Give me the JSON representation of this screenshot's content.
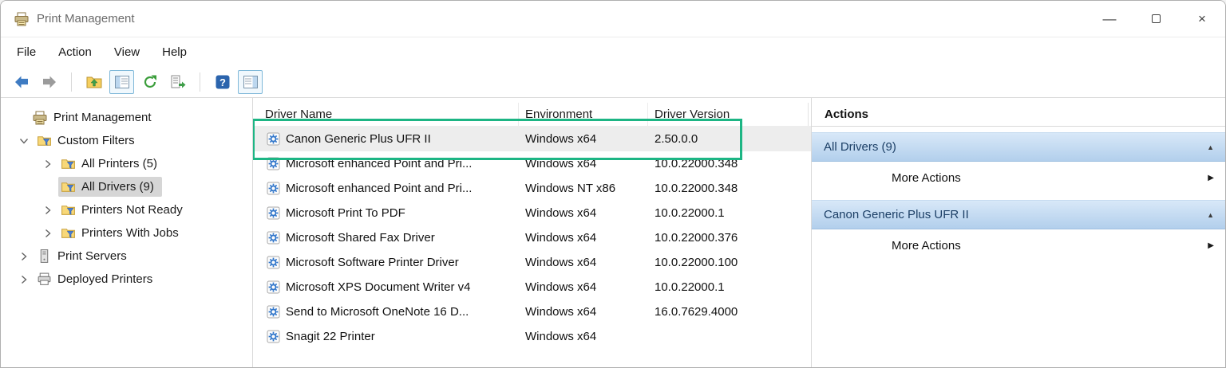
{
  "window": {
    "title": "Print Management"
  },
  "icons": {
    "minimize_glyph": "—",
    "close_glyph": "×",
    "collapse_glyph": "▲",
    "submenu_glyph": "▶"
  },
  "menu": {
    "items": [
      "File",
      "Action",
      "View",
      "Help"
    ]
  },
  "toolbar": {
    "buttons": [
      {
        "name": "back-button",
        "icon": "back-icon"
      },
      {
        "name": "forward-button",
        "icon": "forward-icon"
      },
      {
        "type": "separator"
      },
      {
        "name": "up-level-button",
        "icon": "folder-up-icon"
      },
      {
        "name": "console-tree-toggle-button",
        "icon": "console-tree-icon",
        "active": true
      },
      {
        "name": "refresh-button",
        "icon": "refresh-icon"
      },
      {
        "name": "export-list-button",
        "icon": "export-list-icon"
      },
      {
        "type": "separator"
      },
      {
        "name": "help-button",
        "icon": "help-icon"
      },
      {
        "name": "action-pane-toggle-button",
        "icon": "action-pane-icon",
        "active": true
      }
    ]
  },
  "tree": {
    "items": [
      {
        "label": "Print Management",
        "level": 0,
        "chevron": "none",
        "icon": "print-management-icon"
      },
      {
        "label": "Custom Filters",
        "level": 1,
        "chevron": "down",
        "icon": "filter-folder-icon"
      },
      {
        "label": "All Printers (5)",
        "level": 2,
        "chevron": "right",
        "icon": "filter-folder-icon"
      },
      {
        "label": "All Drivers (9)",
        "level": 2,
        "chevron": "none",
        "icon": "filter-folder-icon",
        "selected": true
      },
      {
        "label": "Printers Not Ready",
        "level": 2,
        "chevron": "right",
        "icon": "filter-folder-icon"
      },
      {
        "label": "Printers With Jobs",
        "level": 2,
        "chevron": "right",
        "icon": "filter-folder-icon"
      },
      {
        "label": "Print Servers",
        "level": 1,
        "chevron": "right",
        "icon": "server-icon"
      },
      {
        "label": "Deployed Printers",
        "level": 1,
        "chevron": "right",
        "icon": "printer-icon"
      }
    ]
  },
  "list": {
    "columns": [
      "Driver Name",
      "Environment",
      "Driver Version"
    ],
    "rows": [
      {
        "name": "Canon Generic Plus UFR II",
        "environment": "Windows x64",
        "version": "2.50.0.0",
        "selected": true
      },
      {
        "name": "Microsoft enhanced Point and Pri...",
        "environment": "Windows x64",
        "version": "10.0.22000.348"
      },
      {
        "name": "Microsoft enhanced Point and Pri...",
        "environment": "Windows NT x86",
        "version": "10.0.22000.348"
      },
      {
        "name": "Microsoft Print To PDF",
        "environment": "Windows x64",
        "version": "10.0.22000.1"
      },
      {
        "name": "Microsoft Shared Fax Driver",
        "environment": "Windows x64",
        "version": "10.0.22000.376"
      },
      {
        "name": "Microsoft Software Printer Driver",
        "environment": "Windows x64",
        "version": "10.0.22000.100"
      },
      {
        "name": "Microsoft XPS Document Writer v4",
        "environment": "Windows x64",
        "version": "10.0.22000.1"
      },
      {
        "name": "Send to Microsoft OneNote 16 D...",
        "environment": "Windows x64",
        "version": "16.0.7629.4000"
      },
      {
        "name": "Snagit 22 Printer",
        "environment": "Windows x64",
        "version": ""
      }
    ]
  },
  "actions": {
    "title": "Actions",
    "sections": [
      {
        "header": "All Drivers (9)",
        "items": [
          "More Actions"
        ]
      },
      {
        "header": "Canon Generic Plus UFR II",
        "items": [
          "More Actions"
        ]
      }
    ]
  },
  "annotation": {
    "highlight_color": "#1db584"
  }
}
